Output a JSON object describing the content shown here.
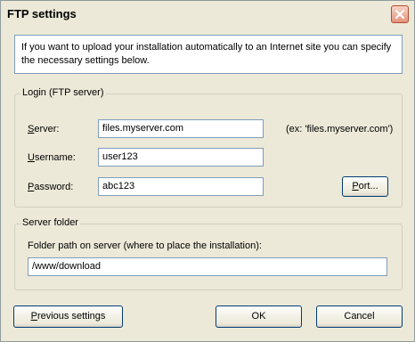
{
  "window": {
    "title": "FTP settings"
  },
  "info": {
    "text": "If you want to upload your installation automatically to an Internet site you can specify the necessary settings below."
  },
  "login": {
    "legend": "Login (FTP server)",
    "server_label_key": "S",
    "server_label_rest": "erver:",
    "server_value": "files.myserver.com",
    "server_hint": "(ex: 'files.myserver.com')",
    "username_label_key": "U",
    "username_label_rest": "sername:",
    "username_value": "user123",
    "password_label_key": "P",
    "password_label_rest": "assword:",
    "password_value": "abc123",
    "port_button_key": "P",
    "port_button_rest": "ort..."
  },
  "folder": {
    "legend": "Server folder",
    "path_label": "Folder path on server (where to place the installation):",
    "path_value": "/www/download"
  },
  "buttons": {
    "previous_key": "P",
    "previous_rest": "revious settings",
    "ok": "OK",
    "cancel": "Cancel"
  },
  "icons": {
    "close": "close-icon"
  },
  "colors": {
    "dialog_bg": "#ece9d8",
    "field_border": "#7f9db9",
    "button_border": "#003c74",
    "close_button": "#e6937d"
  }
}
